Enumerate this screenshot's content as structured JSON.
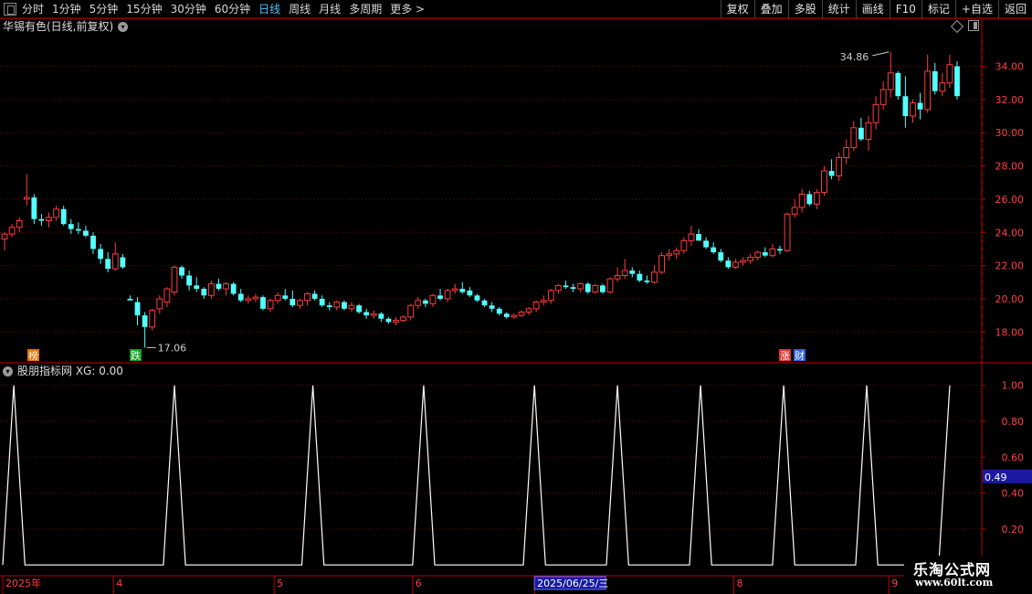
{
  "toolbar": {
    "periods": [
      "分时",
      "1分钟",
      "5分钟",
      "15分钟",
      "30分钟",
      "60分钟",
      "日线",
      "周线",
      "月线",
      "多周期",
      "更多 >"
    ],
    "active_period": "日线",
    "right_buttons": [
      "复权",
      "叠加",
      "多股",
      "统计",
      "画线",
      "F10",
      "标记",
      "+自选",
      "返回"
    ]
  },
  "main_panel": {
    "title": "华锡有色(日线,前复权)",
    "high_label": "34.86",
    "low_label": "17.06",
    "markers": [
      {
        "text": "榜",
        "color": "#e07000"
      },
      {
        "text": "跌",
        "color": "#10a020"
      },
      {
        "text": "涨",
        "color": "#e03030"
      },
      {
        "text": "财",
        "color": "#3060e0"
      }
    ]
  },
  "indicator_panel": {
    "title": "股朋指标网 XG: 0.00",
    "current_value_label": "0.49"
  },
  "watermark": {
    "line1": "乐淘公式网",
    "line2": "www.60lt.com"
  },
  "colors": {
    "up": "#ff3c3c",
    "down": "#54ffff",
    "grid": "#7a0000",
    "axis": "#c00000",
    "tick": "#ff4040",
    "line": "#ffffff"
  },
  "chart_data": [
    {
      "type": "candlestick",
      "title": "",
      "y_ticks": [
        18,
        20,
        22,
        24,
        26,
        28,
        30,
        32,
        34
      ],
      "ylim": [
        16.2,
        35.9
      ],
      "annotations": [
        {
          "text": "34.86",
          "at": "high"
        },
        {
          "text": "17.06",
          "at": "low"
        }
      ],
      "candles": [
        [
          23.6,
          24.0,
          22.9,
          23.9
        ],
        [
          23.9,
          24.5,
          23.7,
          24.3
        ],
        [
          24.3,
          24.9,
          24.0,
          24.7
        ],
        [
          26.0,
          27.5,
          25.6,
          26.1
        ],
        [
          26.1,
          26.3,
          24.5,
          24.8
        ],
        [
          24.8,
          25.1,
          24.4,
          24.7
        ],
        [
          24.7,
          25.2,
          24.3,
          24.9
        ],
        [
          24.9,
          25.6,
          24.7,
          25.4
        ],
        [
          25.4,
          25.6,
          24.4,
          24.5
        ],
        [
          24.5,
          24.8,
          23.9,
          24.2
        ],
        [
          24.2,
          24.6,
          23.9,
          24.1
        ],
        [
          24.1,
          24.4,
          23.7,
          23.8
        ],
        [
          23.8,
          24.0,
          22.7,
          23.0
        ],
        [
          23.0,
          23.3,
          22.1,
          22.4
        ],
        [
          22.4,
          22.8,
          21.6,
          21.8
        ],
        [
          21.8,
          23.4,
          21.7,
          22.7
        ],
        [
          22.5,
          22.7,
          21.8,
          21.9
        ],
        [
          20.0,
          20.2,
          19.9,
          19.9
        ],
        [
          19.8,
          20.1,
          18.4,
          19.0
        ],
        [
          19.0,
          19.2,
          17.06,
          18.3
        ],
        [
          18.3,
          19.4,
          18.1,
          19.3
        ],
        [
          19.4,
          20.2,
          19.1,
          20.0
        ],
        [
          19.8,
          20.7,
          19.5,
          20.6
        ],
        [
          20.4,
          22.0,
          20.2,
          21.9
        ],
        [
          21.9,
          22.0,
          21.2,
          21.4
        ],
        [
          21.4,
          21.7,
          20.5,
          20.8
        ],
        [
          20.8,
          21.3,
          20.4,
          20.6
        ],
        [
          20.6,
          20.7,
          20.0,
          20.2
        ],
        [
          20.2,
          21.1,
          20.0,
          20.9
        ],
        [
          20.9,
          21.2,
          20.5,
          20.6
        ],
        [
          20.6,
          21.0,
          20.2,
          20.9
        ],
        [
          20.9,
          21.0,
          20.2,
          20.3
        ],
        [
          20.3,
          20.6,
          19.8,
          19.9
        ],
        [
          19.9,
          20.2,
          19.7,
          20.0
        ],
        [
          20.0,
          20.3,
          19.8,
          20.1
        ],
        [
          20.1,
          20.2,
          19.3,
          19.4
        ],
        [
          19.4,
          20.0,
          19.2,
          19.9
        ],
        [
          19.9,
          20.4,
          19.7,
          20.2
        ],
        [
          20.2,
          20.6,
          19.9,
          20.0
        ],
        [
          20.0,
          20.5,
          19.5,
          19.6
        ],
        [
          19.6,
          20.0,
          19.4,
          19.9
        ],
        [
          19.9,
          20.4,
          19.6,
          20.3
        ],
        [
          20.3,
          20.5,
          19.9,
          20.0
        ],
        [
          20.0,
          20.2,
          19.5,
          19.6
        ],
        [
          19.6,
          19.8,
          19.3,
          19.5
        ],
        [
          19.5,
          19.9,
          19.3,
          19.8
        ],
        [
          19.8,
          19.9,
          19.3,
          19.4
        ],
        [
          19.4,
          19.8,
          19.2,
          19.6
        ],
        [
          19.6,
          19.7,
          19.1,
          19.2
        ],
        [
          19.2,
          19.4,
          18.8,
          19.0
        ],
        [
          19.0,
          19.3,
          18.8,
          19.1
        ],
        [
          19.1,
          19.2,
          18.6,
          18.8
        ],
        [
          18.8,
          18.9,
          18.5,
          18.6
        ],
        [
          18.6,
          18.9,
          18.4,
          18.7
        ],
        [
          18.7,
          19.0,
          18.6,
          18.9
        ],
        [
          18.9,
          19.7,
          18.7,
          19.6
        ],
        [
          19.6,
          20.1,
          19.4,
          19.9
        ],
        [
          19.9,
          20.0,
          19.5,
          19.7
        ],
        [
          19.7,
          20.3,
          19.5,
          20.2
        ],
        [
          20.2,
          20.6,
          19.9,
          20.0
        ],
        [
          20.0,
          20.6,
          19.8,
          20.5
        ],
        [
          20.5,
          20.9,
          20.3,
          20.6
        ],
        [
          20.6,
          21.0,
          20.3,
          20.4
        ],
        [
          20.5,
          20.7,
          20.1,
          20.2
        ],
        [
          20.2,
          20.3,
          19.8,
          19.9
        ],
        [
          19.9,
          20.0,
          19.5,
          19.6
        ],
        [
          19.6,
          19.8,
          19.2,
          19.4
        ],
        [
          19.4,
          19.5,
          19.0,
          19.1
        ],
        [
          19.1,
          19.2,
          18.8,
          18.9
        ],
        [
          18.9,
          19.1,
          18.8,
          19.0
        ],
        [
          19.0,
          19.3,
          18.9,
          19.2
        ],
        [
          19.2,
          19.5,
          19.0,
          19.4
        ],
        [
          19.4,
          19.9,
          19.2,
          19.8
        ],
        [
          19.8,
          20.2,
          19.6,
          19.9
        ],
        [
          19.9,
          20.6,
          19.7,
          20.5
        ],
        [
          20.5,
          20.9,
          20.3,
          20.8
        ],
        [
          20.8,
          21.1,
          20.6,
          20.7
        ],
        [
          20.7,
          20.9,
          20.4,
          20.6
        ],
        [
          20.6,
          21.0,
          20.4,
          20.9
        ],
        [
          20.9,
          21.0,
          20.3,
          20.4
        ],
        [
          20.4,
          20.9,
          20.3,
          20.8
        ],
        [
          20.8,
          20.9,
          20.3,
          20.4
        ],
        [
          20.4,
          21.3,
          20.3,
          21.2
        ],
        [
          21.2,
          21.9,
          21.0,
          21.4
        ],
        [
          21.4,
          22.4,
          21.2,
          21.7
        ],
        [
          21.7,
          21.9,
          21.3,
          21.5
        ],
        [
          21.5,
          21.7,
          21.0,
          21.1
        ],
        [
          21.1,
          21.4,
          20.9,
          21.0
        ],
        [
          21.0,
          22.0,
          20.9,
          21.6
        ],
        [
          21.6,
          22.8,
          21.5,
          22.6
        ],
        [
          22.6,
          23.0,
          22.3,
          22.7
        ],
        [
          22.7,
          23.1,
          22.4,
          22.9
        ],
        [
          22.9,
          23.7,
          22.7,
          23.5
        ],
        [
          23.5,
          24.4,
          23.2,
          23.9
        ],
        [
          23.9,
          24.2,
          23.5,
          23.5
        ],
        [
          23.5,
          23.7,
          23.0,
          23.1
        ],
        [
          23.1,
          23.4,
          22.7,
          22.8
        ],
        [
          22.8,
          23.0,
          22.2,
          22.3
        ],
        [
          22.3,
          22.5,
          21.8,
          21.9
        ],
        [
          21.9,
          22.4,
          21.8,
          22.2
        ],
        [
          22.2,
          22.5,
          22.0,
          22.3
        ],
        [
          22.3,
          22.7,
          22.1,
          22.5
        ],
        [
          22.5,
          22.9,
          22.3,
          22.8
        ],
        [
          22.8,
          23.1,
          22.5,
          22.6
        ],
        [
          22.6,
          23.3,
          22.5,
          23.0
        ],
        [
          23.0,
          23.2,
          22.7,
          22.9
        ],
        [
          22.9,
          25.2,
          22.8,
          25.1
        ],
        [
          25.1,
          26.0,
          24.9,
          25.5
        ],
        [
          25.5,
          26.6,
          25.2,
          26.3
        ],
        [
          26.3,
          26.5,
          25.6,
          25.7
        ],
        [
          25.7,
          26.6,
          25.4,
          26.4
        ],
        [
          26.4,
          28.0,
          26.2,
          27.7
        ],
        [
          27.7,
          28.4,
          27.2,
          27.4
        ],
        [
          27.4,
          28.8,
          27.1,
          28.5
        ],
        [
          28.5,
          29.6,
          28.1,
          29.1
        ],
        [
          29.1,
          30.7,
          28.9,
          30.3
        ],
        [
          30.3,
          30.9,
          29.5,
          29.6
        ],
        [
          29.6,
          31.0,
          28.9,
          30.6
        ],
        [
          30.6,
          32.2,
          30.2,
          31.7
        ],
        [
          31.7,
          33.1,
          31.4,
          32.6
        ],
        [
          32.6,
          34.86,
          32.1,
          33.6
        ],
        [
          33.6,
          33.7,
          32.0,
          32.2
        ],
        [
          32.2,
          33.4,
          30.3,
          31.0
        ],
        [
          31.0,
          32.0,
          30.6,
          31.8
        ],
        [
          31.8,
          32.4,
          30.8,
          31.4
        ],
        [
          31.4,
          34.7,
          31.2,
          33.7
        ],
        [
          33.7,
          34.2,
          32.3,
          32.5
        ],
        [
          32.5,
          33.6,
          32.2,
          33.0
        ],
        [
          33.0,
          34.7,
          32.7,
          34.1
        ],
        [
          34.0,
          34.3,
          32.0,
          32.2
        ]
      ]
    },
    {
      "type": "line",
      "title": "",
      "series": [
        {
          "name": "XG",
          "peak_indices": [
            2,
            31,
            56,
            76,
            96,
            111,
            126,
            141,
            156,
            171
          ]
        }
      ],
      "x_count": 172,
      "y_ticks": [
        0.2,
        0.4,
        0.6,
        0.8,
        1.0
      ],
      "ylim": [
        -0.05,
        1.1
      ]
    }
  ],
  "x_axis": {
    "labels": [
      {
        "text": "2025年",
        "index": 0
      },
      {
        "text": "4",
        "index": 20
      },
      {
        "text": "5",
        "index": 49
      },
      {
        "text": "6",
        "index": 74
      },
      {
        "text": "2025/06/25/三",
        "index": 96,
        "cursor": true
      },
      {
        "text": "8",
        "index": 132
      },
      {
        "text": "9",
        "index": 160
      }
    ]
  }
}
